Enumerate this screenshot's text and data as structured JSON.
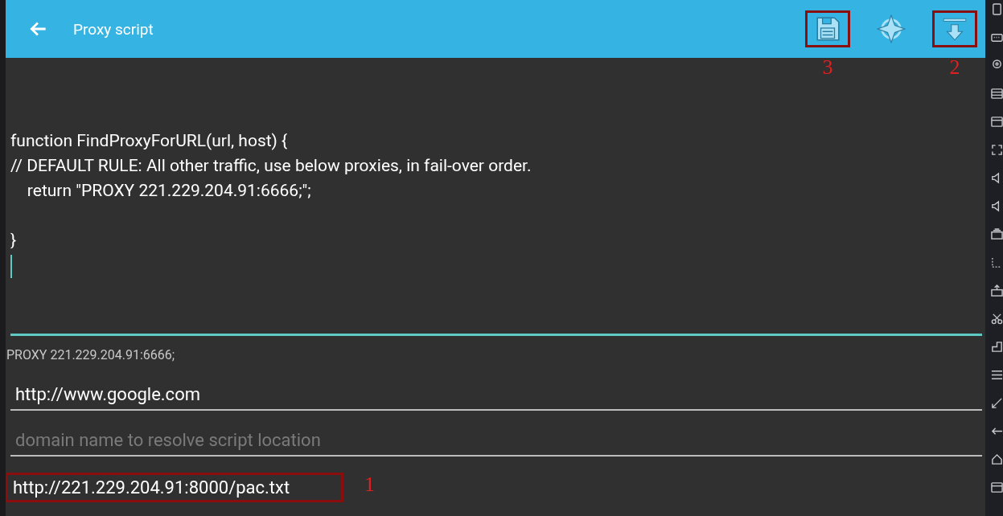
{
  "app_bar": {
    "title": "Proxy script",
    "actions": [
      {
        "kind": "save",
        "callout": "3"
      },
      {
        "kind": "locate"
      },
      {
        "kind": "download",
        "callout": "2"
      }
    ]
  },
  "script_editor": {
    "value": "function FindProxyForURL(url, host) {\n// DEFAULT RULE: All other traffic, use below proxies, in fail-over order.\n    return \"PROXY 221.229.204.91:6666;\";\n\n}",
    "focused": true
  },
  "result": "PROXY 221.229.204.91:6666;",
  "fields": [
    {
      "value": "http://www.google.com"
    },
    {
      "placeholder": "domain name to resolve script location"
    },
    {
      "value": "http://221.229.204.91:8000/pac.txt",
      "callout": "1"
    }
  ]
}
